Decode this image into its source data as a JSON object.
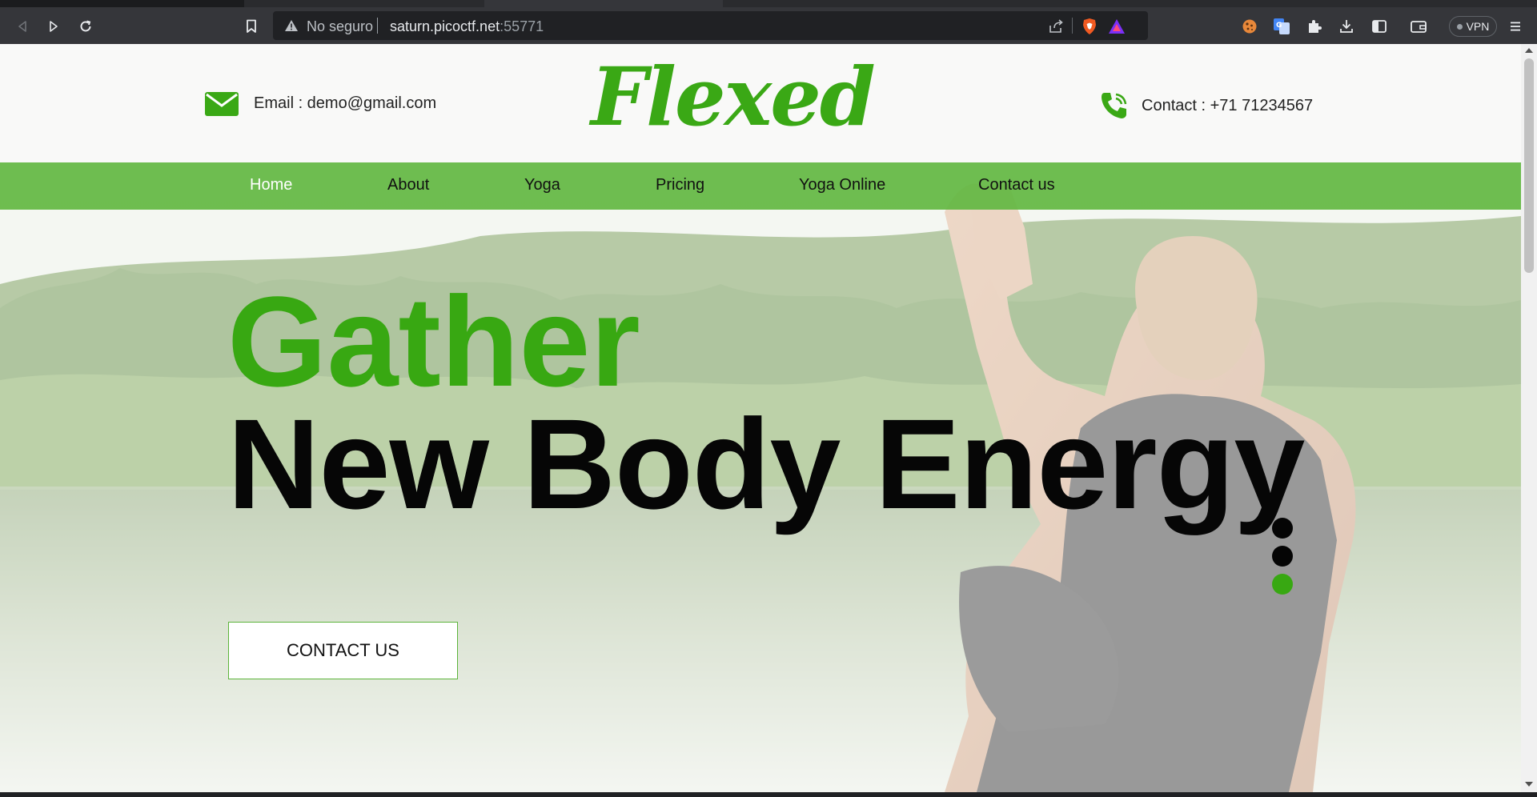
{
  "browser": {
    "security_label": "No seguro",
    "url_host": "saturn.picoctf.net",
    "url_port": ":55771",
    "vpn_label": "VPN",
    "icons": [
      "back-icon",
      "forward-icon",
      "reload-icon",
      "bookmark-icon",
      "warning-icon",
      "share-icon",
      "brave-shield-icon",
      "brave-rewards-icon",
      "cookie-extension-icon",
      "translate-extension-icon",
      "extensions-puzzle-icon",
      "downloads-icon",
      "sidebar-icon",
      "wallet-icon",
      "menu-icon"
    ]
  },
  "site": {
    "logo": "Flexed",
    "brand_color": "#38a812",
    "email_label": "Email : demo@gmail.com",
    "contact_label": "Contact : +71 71234567",
    "nav": [
      {
        "label": "Home",
        "active": true
      },
      {
        "label": "About",
        "active": false
      },
      {
        "label": "Yoga",
        "active": false
      },
      {
        "label": "Pricing",
        "active": false
      },
      {
        "label": "Yoga Online",
        "active": false
      },
      {
        "label": "Contact us",
        "active": false
      }
    ],
    "nav_color": "#63b843",
    "hero": {
      "line1": "Gather",
      "line2": "New Body Energy",
      "cta_label": "CONTACT US"
    },
    "slider": {
      "count": 3,
      "active_index": 2
    }
  }
}
